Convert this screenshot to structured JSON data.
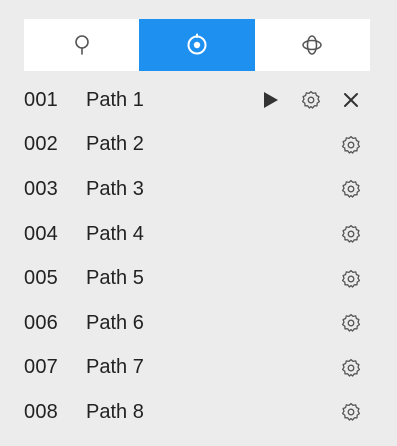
{
  "tabs": [
    {
      "name": "preset",
      "icon": "location-pin-icon",
      "active": false
    },
    {
      "name": "patrol",
      "icon": "target-circle-icon",
      "active": true
    },
    {
      "name": "pattern",
      "icon": "orbit-icon",
      "active": false
    }
  ],
  "paths": [
    {
      "number": "001",
      "label": "Path 1"
    },
    {
      "number": "002",
      "label": "Path 2"
    },
    {
      "number": "003",
      "label": "Path 3"
    },
    {
      "number": "004",
      "label": "Path 4"
    },
    {
      "number": "005",
      "label": "Path 5"
    },
    {
      "number": "006",
      "label": "Path 6"
    },
    {
      "number": "007",
      "label": "Path 7"
    },
    {
      "number": "008",
      "label": "Path 8"
    }
  ],
  "colors": {
    "accent": "#1e90f0",
    "background": "#ececec",
    "icon": "#555555"
  }
}
